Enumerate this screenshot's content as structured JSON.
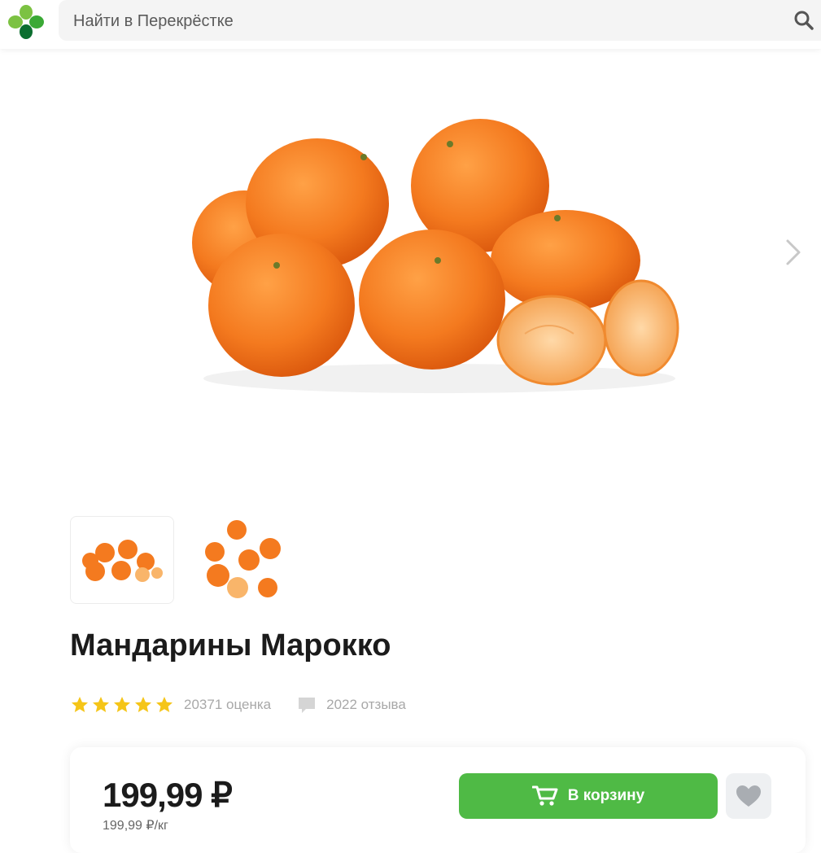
{
  "header": {
    "search_placeholder": "Найти в Перекрёстке",
    "logo_icon": "perekrestok-clover-logo",
    "search_icon": "search-icon"
  },
  "gallery": {
    "main_image": "mandarins-main-photo",
    "next_icon": "chevron-right-icon",
    "thumbnails": [
      "mandarins-pile-thumb",
      "mandarins-scattered-thumb"
    ]
  },
  "product": {
    "title": "Мандарины Марокко",
    "rating_stars": 5,
    "rating_count": "20371 оценка",
    "reviews_count": "2022 отзыва"
  },
  "price_card": {
    "price": "199,99 ₽",
    "unit_price": "199,99 ₽/кг",
    "cart_label": "В корзину",
    "cart_icon": "cart-icon",
    "favorite_icon": "heart-icon"
  },
  "colors": {
    "accent_green": "#4fba45",
    "star_yellow": "#f5c518",
    "orange": "#f47a1f"
  }
}
